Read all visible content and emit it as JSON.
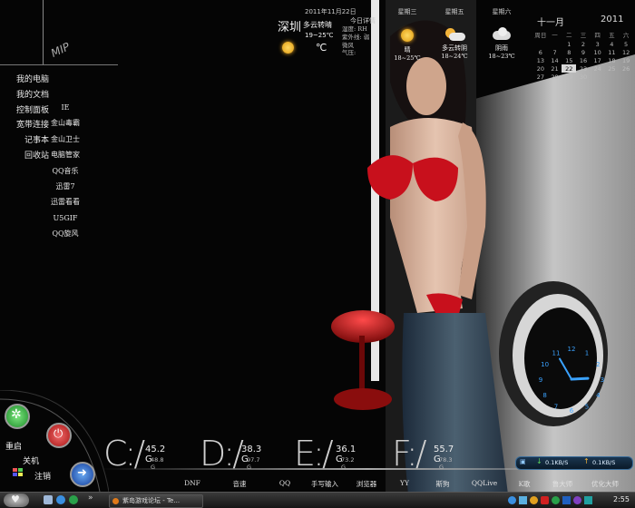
{
  "desktop_shortcuts_left": [
    "我的电脑",
    "我的文档",
    "控制面板",
    "宽带连接",
    "记事本",
    "回收站"
  ],
  "desktop_shortcuts_right": [
    "IE",
    "金山毒霸",
    "金山卫士",
    "电脑管家",
    "QQ音乐",
    "迅雷7",
    "迅雷看看",
    "U5GIF",
    "QQ旋风"
  ],
  "logo_text": "MIP",
  "weather": {
    "date": "2011年11月22日",
    "city": "深圳",
    "today": {
      "condition": "多云转晴",
      "temp_range": "19~25℃",
      "unit": "℃"
    },
    "details_title": "今日详情",
    "details": [
      "湿度: RH",
      "紫外线: 弱",
      "微风",
      "气压:"
    ],
    "forecast": [
      {
        "weekday": "星期三",
        "label": "",
        "condition": "晴",
        "temp": "18~25℃",
        "icon": "sun-icon"
      },
      {
        "weekday": "星期五",
        "label": "多云转阴",
        "condition": "多云转阴",
        "temp": "18~24℃",
        "icon": "cloud-sun-icon"
      },
      {
        "weekday": "星期六",
        "label": "阴雨",
        "condition": "阴雨",
        "temp": "18~23℃",
        "icon": "cloud-icon"
      }
    ]
  },
  "calendar": {
    "month": "十一月",
    "year": "2011",
    "weekdays": [
      "周日",
      "一",
      "二",
      "三",
      "四",
      "五",
      "六"
    ],
    "rows": [
      [
        "",
        "",
        "1",
        "2",
        "3",
        "4",
        "5"
      ],
      [
        "6",
        "7",
        "8",
        "9",
        "10",
        "11",
        "12"
      ],
      [
        "13",
        "14",
        "15",
        "16",
        "17",
        "18",
        "19"
      ],
      [
        "20",
        "21",
        "22",
        "23",
        "24",
        "25",
        "26"
      ],
      [
        "27",
        "28",
        "29",
        "30",
        "",
        "",
        ""
      ]
    ],
    "today": "22"
  },
  "power_menu": {
    "restart": "重启",
    "shutdown": "关机",
    "logoff": "注销"
  },
  "drives": [
    {
      "letter": "C:/",
      "free": "45.2 G",
      "total": "48.8 G"
    },
    {
      "letter": "D:/",
      "free": "38.3 G",
      "total": "97.7 G"
    },
    {
      "letter": "E:/",
      "free": "36.1 G",
      "total": "73.2 G"
    },
    {
      "letter": "F:/",
      "free": "55.7 G",
      "total": "78.3 G"
    }
  ],
  "dock": [
    "DNF",
    "音速",
    "QQ",
    "手写输入",
    "浏览器",
    "YY",
    "斯狗",
    "QQLive",
    "K歌",
    "鲁大师",
    "优化大师"
  ],
  "network": {
    "down": "0.1KB/S",
    "up": "0.1KB/S"
  },
  "clock_face": {
    "numbers": [
      "12",
      "1",
      "2",
      "3",
      "4",
      "5",
      "6",
      "7",
      "8",
      "9",
      "10",
      "11"
    ],
    "hour": 2.9,
    "minute": 55
  },
  "taskbar": {
    "window_title": "紫岛游戏论坛 - Te...",
    "time": "2:55"
  },
  "colors": {
    "accent_green": "#37c14a",
    "accent_red": "#e03a3a",
    "accent_blue": "#2e7fd8",
    "bikini_red": "#c8101c",
    "clock_blue": "#3aa2ff"
  }
}
